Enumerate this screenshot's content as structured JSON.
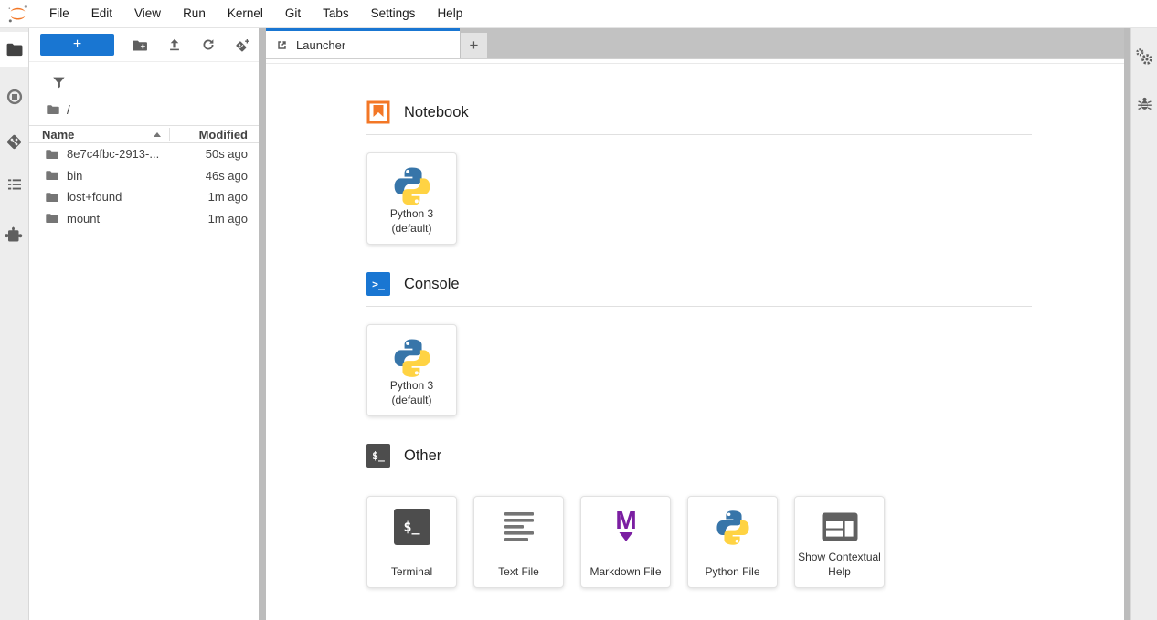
{
  "menu_bar": {
    "items": [
      "File",
      "Edit",
      "View",
      "Run",
      "Kernel",
      "Git",
      "Tabs",
      "Settings",
      "Help"
    ]
  },
  "file_browser": {
    "new_launcher_button": "+",
    "breadcrumb_root": "/",
    "columns": {
      "name": "Name",
      "modified": "Modified"
    },
    "files": [
      {
        "name": "8e7c4fbc-2913-...",
        "modified": "50s ago"
      },
      {
        "name": "bin",
        "modified": "46s ago"
      },
      {
        "name": "lost+found",
        "modified": "1m ago"
      },
      {
        "name": "mount",
        "modified": "1m ago"
      }
    ]
  },
  "tab_bar": {
    "active_tab_label": "Launcher",
    "new_tab_button": "+"
  },
  "launcher": {
    "sections": {
      "notebook": {
        "title": "Notebook",
        "card": {
          "label_line1": "Python 3",
          "label_line2": "(default)"
        }
      },
      "console": {
        "title": "Console",
        "card": {
          "label_line1": "Python 3",
          "label_line2": "(default)"
        }
      },
      "other": {
        "title": "Other",
        "cards": [
          {
            "label": "Terminal"
          },
          {
            "label": "Text File"
          },
          {
            "label": "Markdown File"
          },
          {
            "label": "Python File"
          },
          {
            "label": "Show Contextual Help"
          }
        ]
      }
    }
  },
  "icon_glyphs": {
    "console": ">_",
    "terminal": "$_",
    "markdown": "M"
  },
  "colors": {
    "accent_blue": "#1976d2",
    "jupyter_orange": "#f37726",
    "markdown_purple": "#7b1fa2",
    "terminal_gray": "#4d4d4d",
    "python_blue": "#3775a9",
    "python_yellow": "#ffd343"
  }
}
